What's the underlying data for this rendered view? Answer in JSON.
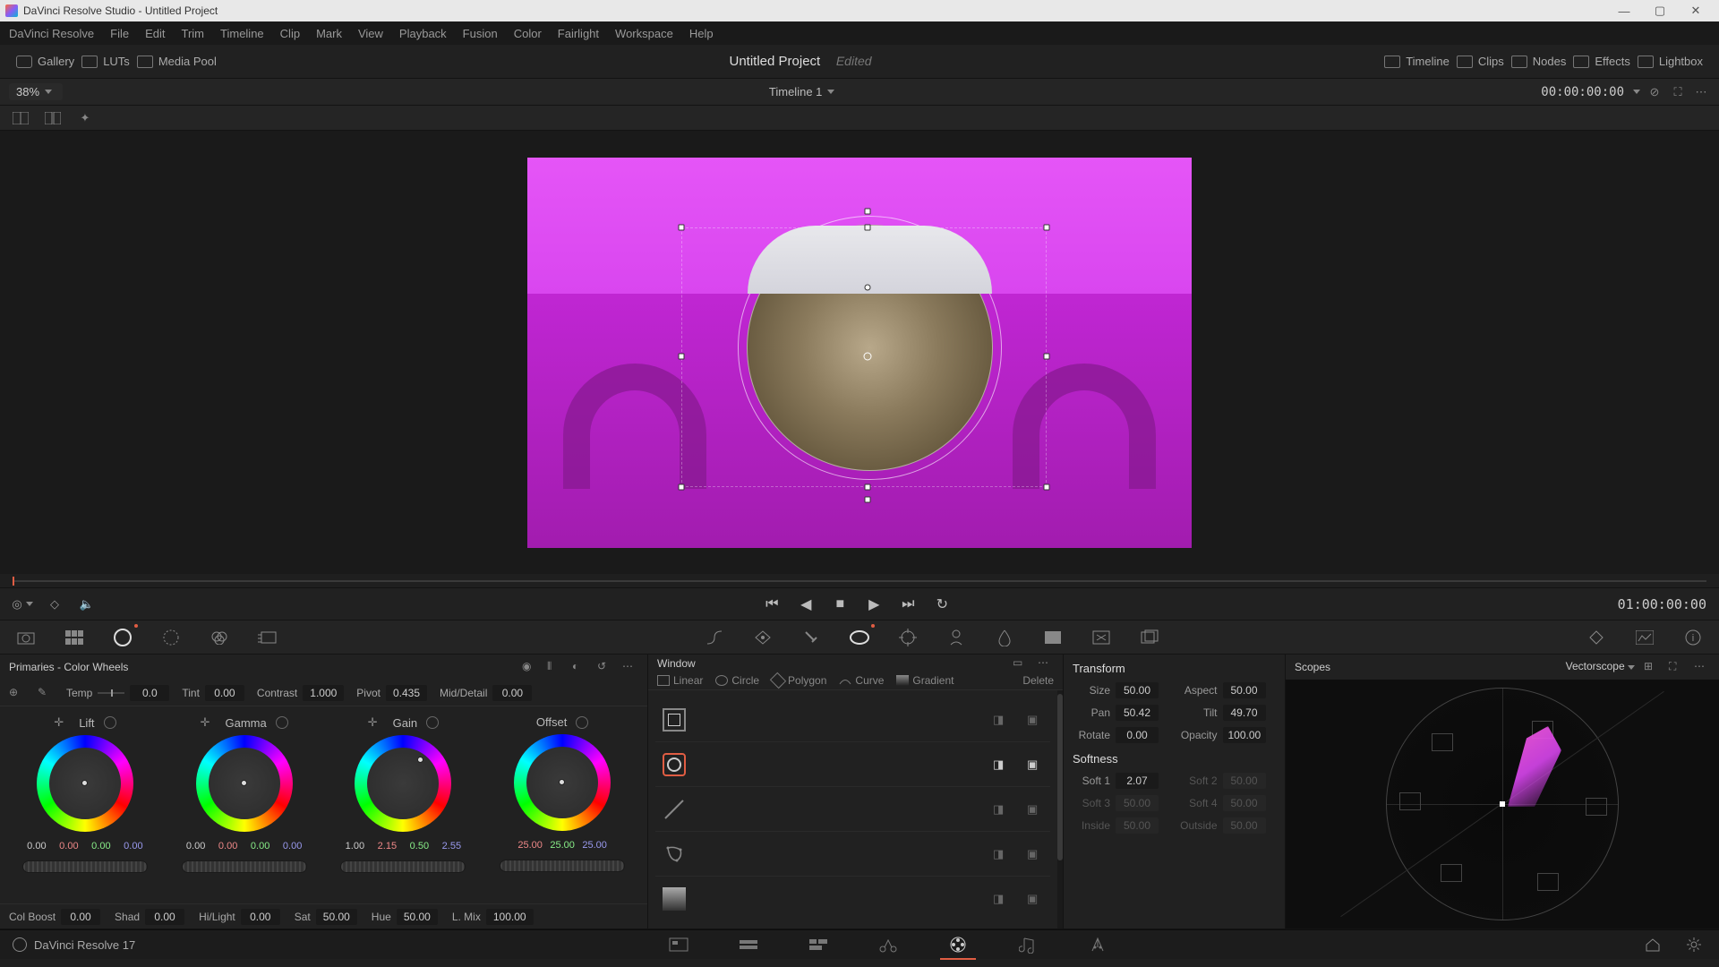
{
  "app": {
    "title": "DaVinci Resolve Studio - Untitled Project"
  },
  "menu": [
    "DaVinci Resolve",
    "File",
    "Edit",
    "Trim",
    "Timeline",
    "Clip",
    "Mark",
    "View",
    "Playback",
    "Fusion",
    "Color",
    "Fairlight",
    "Workspace",
    "Help"
  ],
  "toolbar": {
    "gallery": "Gallery",
    "luts": "LUTs",
    "media_pool": "Media Pool",
    "project_title": "Untitled Project",
    "edited": "Edited",
    "timeline": "Timeline",
    "clips": "Clips",
    "nodes": "Nodes",
    "effects": "Effects",
    "lightbox": "Lightbox"
  },
  "sub": {
    "zoom": "38%",
    "timeline_name": "Timeline 1",
    "timecode": "00:00:00:00"
  },
  "transport": {
    "timecode": "01:00:00:00"
  },
  "primaries": {
    "title": "Primaries - Color Wheels",
    "row1": {
      "temp_label": "Temp",
      "temp_val": "0.0",
      "tint_label": "Tint",
      "tint_val": "0.00",
      "contrast_label": "Contrast",
      "contrast_val": "1.000",
      "pivot_label": "Pivot",
      "pivot_val": "0.435",
      "middetail_label": "Mid/Detail",
      "middetail_val": "0.00"
    },
    "wheels": {
      "lift": {
        "label": "Lift",
        "vals": [
          "0.00",
          "0.00",
          "0.00",
          "0.00"
        ]
      },
      "gamma": {
        "label": "Gamma",
        "vals": [
          "0.00",
          "0.00",
          "0.00",
          "0.00"
        ]
      },
      "gain": {
        "label": "Gain",
        "vals": [
          "1.00",
          "2.15",
          "0.50",
          "2.55"
        ]
      },
      "offset": {
        "label": "Offset",
        "vals": [
          "25.00",
          "25.00",
          "25.00"
        ]
      }
    },
    "row3": {
      "colboost_label": "Col Boost",
      "colboost_val": "0.00",
      "shad_label": "Shad",
      "shad_val": "0.00",
      "hilight_label": "Hi/Light",
      "hilight_val": "0.00",
      "sat_label": "Sat",
      "sat_val": "50.00",
      "hue_label": "Hue",
      "hue_val": "50.00",
      "lmix_label": "L. Mix",
      "lmix_val": "100.00"
    }
  },
  "window": {
    "title": "Window",
    "linear": "Linear",
    "circle": "Circle",
    "polygon": "Polygon",
    "curve": "Curve",
    "gradient": "Gradient",
    "delete": "Delete"
  },
  "transform": {
    "title": "Transform",
    "size_label": "Size",
    "size_val": "50.00",
    "aspect_label": "Aspect",
    "aspect_val": "50.00",
    "pan_label": "Pan",
    "pan_val": "50.42",
    "tilt_label": "Tilt",
    "tilt_val": "49.70",
    "rotate_label": "Rotate",
    "rotate_val": "0.00",
    "opacity_label": "Opacity",
    "opacity_val": "100.00",
    "softness_title": "Softness",
    "soft1_label": "Soft 1",
    "soft1_val": "2.07",
    "soft2_label": "Soft 2",
    "soft2_val": "50.00",
    "soft3_label": "Soft 3",
    "soft3_val": "50.00",
    "soft4_label": "Soft 4",
    "soft4_val": "50.00",
    "inside_label": "Inside",
    "inside_val": "50.00",
    "outside_label": "Outside",
    "outside_val": "50.00"
  },
  "scopes": {
    "title": "Scopes",
    "mode": "Vectorscope"
  },
  "footer": {
    "version": "DaVinci Resolve 17"
  }
}
